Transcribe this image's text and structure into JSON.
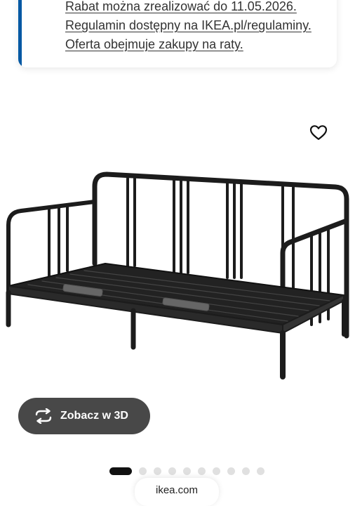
{
  "promo": {
    "lines": [
      "Rabat można zrealizować do 11.05.2026.",
      "Regulamin dostępny na IKEA.pl/regulaminy.",
      "Oferta obejmuje zakupy na raty."
    ]
  },
  "product": {
    "image_alt": "black metal day-bed frame",
    "favourite_icon": "heart-icon"
  },
  "view3d": {
    "label": "Zobacz w 3D",
    "icon": "rotate-3d-icon"
  },
  "carousel": {
    "total": 10,
    "active_index": 0
  },
  "browser": {
    "url": "ikea.com"
  },
  "colors": {
    "accent": "#0058a3",
    "button": "#484848"
  }
}
